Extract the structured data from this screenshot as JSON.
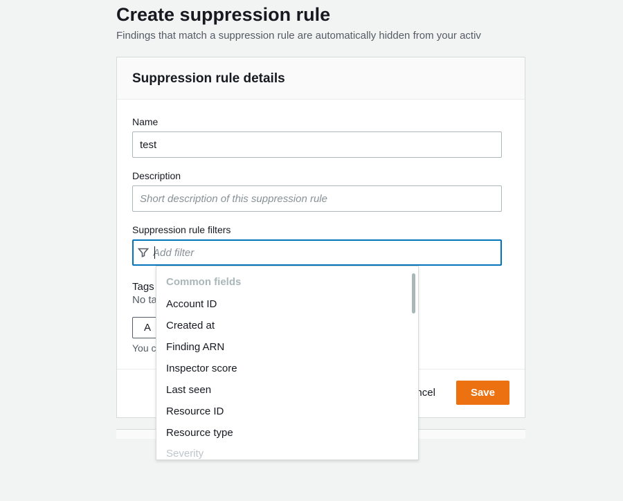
{
  "page": {
    "title": "Create suppression rule",
    "subtext": "Findings that match a suppression rule are automatically hidden from your activ"
  },
  "panel": {
    "title": "Suppression rule details"
  },
  "fields": {
    "name_label": "Name",
    "name_value": "test",
    "description_label": "Description",
    "description_placeholder": "Short description of this suppression rule",
    "filters_label": "Suppression rule filters",
    "filters_placeholder": "Add filter"
  },
  "tags": {
    "label": "Tags",
    "text": "No ta",
    "add_label": "A",
    "hint": "You c"
  },
  "dropdown": {
    "group": "Common fields",
    "items": [
      "Account ID",
      "Created at",
      "Finding ARN",
      "Inspector score",
      "Last seen",
      "Resource ID",
      "Resource type"
    ],
    "partial": "Severity"
  },
  "actions": {
    "cancel": "ancel",
    "save": "Save"
  }
}
